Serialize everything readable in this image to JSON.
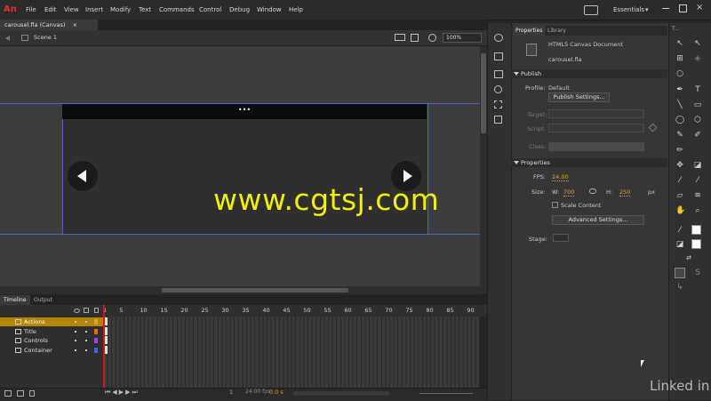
{
  "app": {
    "logo": "An"
  },
  "menu": [
    "File",
    "Edit",
    "View",
    "Insert",
    "Modify",
    "Text",
    "Commands",
    "Control",
    "Debug",
    "Window",
    "Help"
  ],
  "workspace": {
    "label": "Essentials",
    "chevron": "▾"
  },
  "document": {
    "tab": "carousel.fla (Canvas)",
    "close": "×",
    "scene": "Scene 1",
    "zoom": "100%"
  },
  "stage": {
    "title_text": "•••",
    "left_arrow": "◀",
    "right_arrow": "▶",
    "watermark": "www.cgtsj.com"
  },
  "timeline": {
    "tabs": [
      "Timeline",
      "Output"
    ],
    "frame_numbers": [
      "1",
      "5",
      "10",
      "15",
      "20",
      "25",
      "30",
      "35",
      "40",
      "45",
      "50",
      "55",
      "60",
      "65",
      "70",
      "75",
      "80",
      "85",
      "90"
    ],
    "layers": [
      {
        "name": "Actions",
        "color": "#e0a030",
        "selected": true
      },
      {
        "name": "Title",
        "color": "#f06a00",
        "selected": false
      },
      {
        "name": "Controls",
        "color": "#b13cde",
        "selected": false
      },
      {
        "name": "Container",
        "color": "#2f6ee0",
        "selected": false
      }
    ],
    "footer": {
      "frame": "1",
      "fps": "24.00 fps",
      "time": "0.0 s"
    }
  },
  "panel": {
    "tabs": [
      "Properties",
      "Library"
    ],
    "doc_type": "HTML5 Canvas Document",
    "doc_name": "carousel.fla",
    "publish": {
      "header": "Publish",
      "profile_label": "Profile:",
      "profile_value": "Default",
      "settings_btn": "Publish Settings...",
      "target_label": "Target:",
      "script_label": "Script:",
      "class_label": "Class:"
    },
    "properties": {
      "header": "Properties",
      "fps_label": "FPS:",
      "fps_value": "24.00",
      "size_label": "Size:",
      "w_label": "W:",
      "w_value": "700",
      "h_label": "H:",
      "h_value": "250",
      "unit": "px",
      "scale_label": "Scale Content",
      "adv_btn": "Advanced Settings...",
      "stage_label": "Stage:"
    }
  },
  "tools_panel": {
    "title": "T..."
  },
  "branding": {
    "text": "Linked in"
  }
}
